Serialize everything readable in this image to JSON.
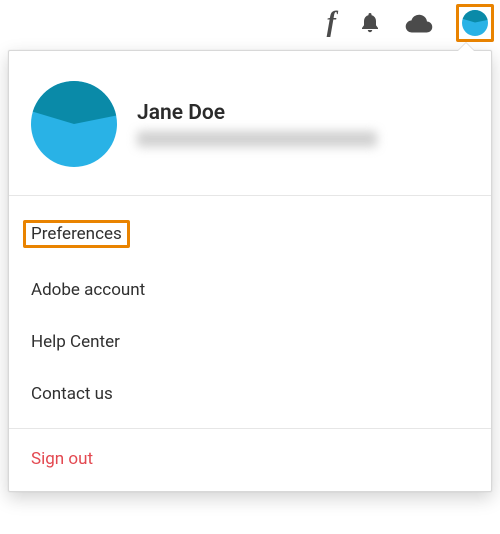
{
  "topbar": {
    "fonts_glyph": "f"
  },
  "user": {
    "name": "Jane Doe"
  },
  "menu": {
    "preferences": "Preferences",
    "adobe_account": "Adobe account",
    "help_center": "Help Center",
    "contact_us": "Contact us"
  },
  "signout_label": "Sign out",
  "colors": {
    "highlight": "#e98300",
    "avatar_light": "#29b2e6",
    "avatar_dark": "#0a8aa8",
    "signout": "#e34850"
  }
}
